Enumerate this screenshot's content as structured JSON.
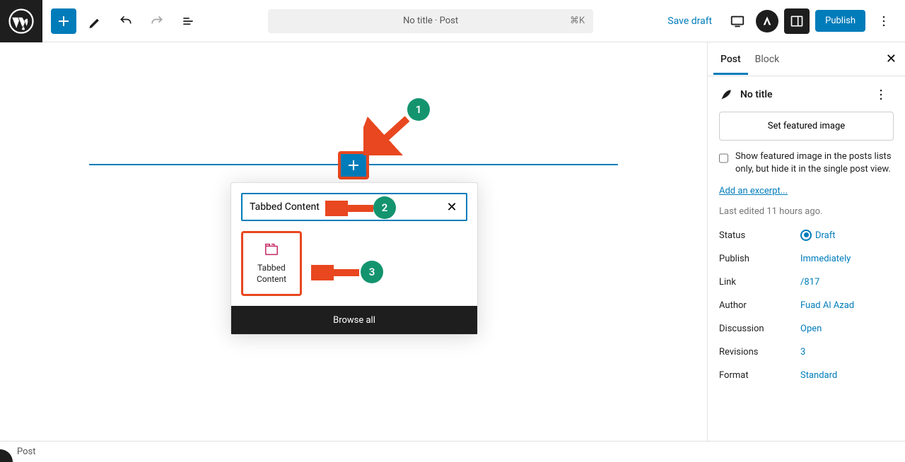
{
  "toolbar": {
    "title": "No title · Post",
    "shortcut": "⌘K",
    "save_draft": "Save draft",
    "publish": "Publish"
  },
  "inserter": {
    "search_value": "Tabbed Content",
    "block_result": {
      "label": "Tabbed Content"
    },
    "browse_all": "Browse all"
  },
  "annotations": {
    "marker1": "1",
    "marker2": "2",
    "marker3": "3"
  },
  "sidebar": {
    "tabs": {
      "post": "Post",
      "block": "Block"
    },
    "doc_title": "No title",
    "featured_button": "Set featured image",
    "checkbox_label": "Show featured image in the posts lists only, but hide it in the single post view.",
    "excerpt_link": "Add an excerpt...",
    "last_edited": "Last edited 11 hours ago.",
    "meta": {
      "status_label": "Status",
      "status_value": "Draft",
      "publish_label": "Publish",
      "publish_value": "Immediately",
      "link_label": "Link",
      "link_value": "/817",
      "author_label": "Author",
      "author_value": "Fuad Al Azad",
      "discussion_label": "Discussion",
      "discussion_value": "Open",
      "revisions_label": "Revisions",
      "revisions_value": "3",
      "format_label": "Format",
      "format_value": "Standard"
    }
  },
  "footer": {
    "breadcrumb": "Post"
  }
}
